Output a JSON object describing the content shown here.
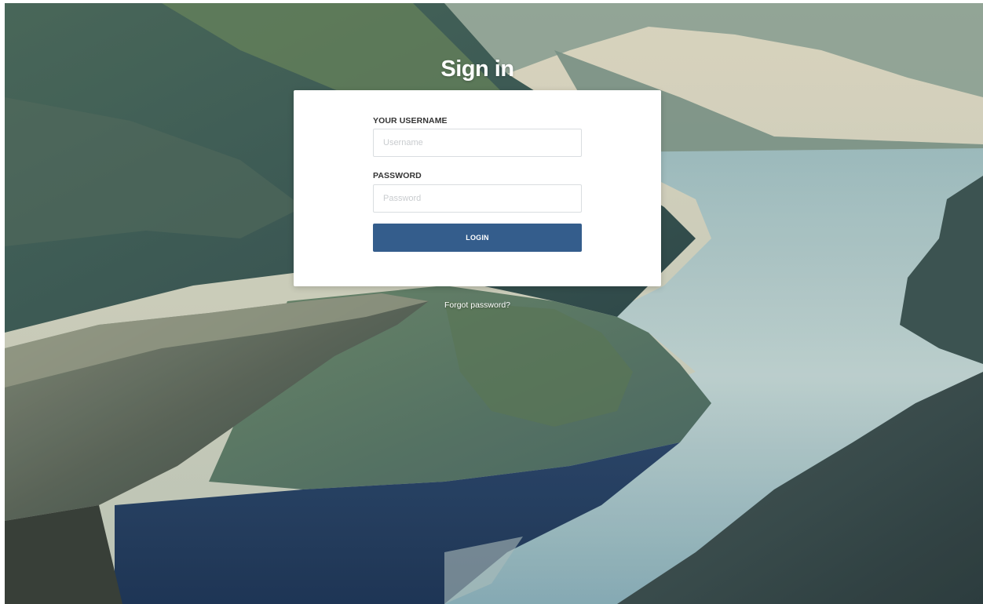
{
  "page": {
    "title": "Sign in"
  },
  "form": {
    "username_label": "YOUR USERNAME",
    "username_placeholder": "Username",
    "username_value": "",
    "password_label": "PASSWORD",
    "password_placeholder": "Password",
    "password_value": "",
    "login_label": "LOGIN",
    "forgot_label": "Forgot password?"
  },
  "colors": {
    "button": "#345d8c",
    "card": "#ffffff",
    "title_text": "#ffffff"
  },
  "background": {
    "icon": "fjord-landscape-photo"
  }
}
